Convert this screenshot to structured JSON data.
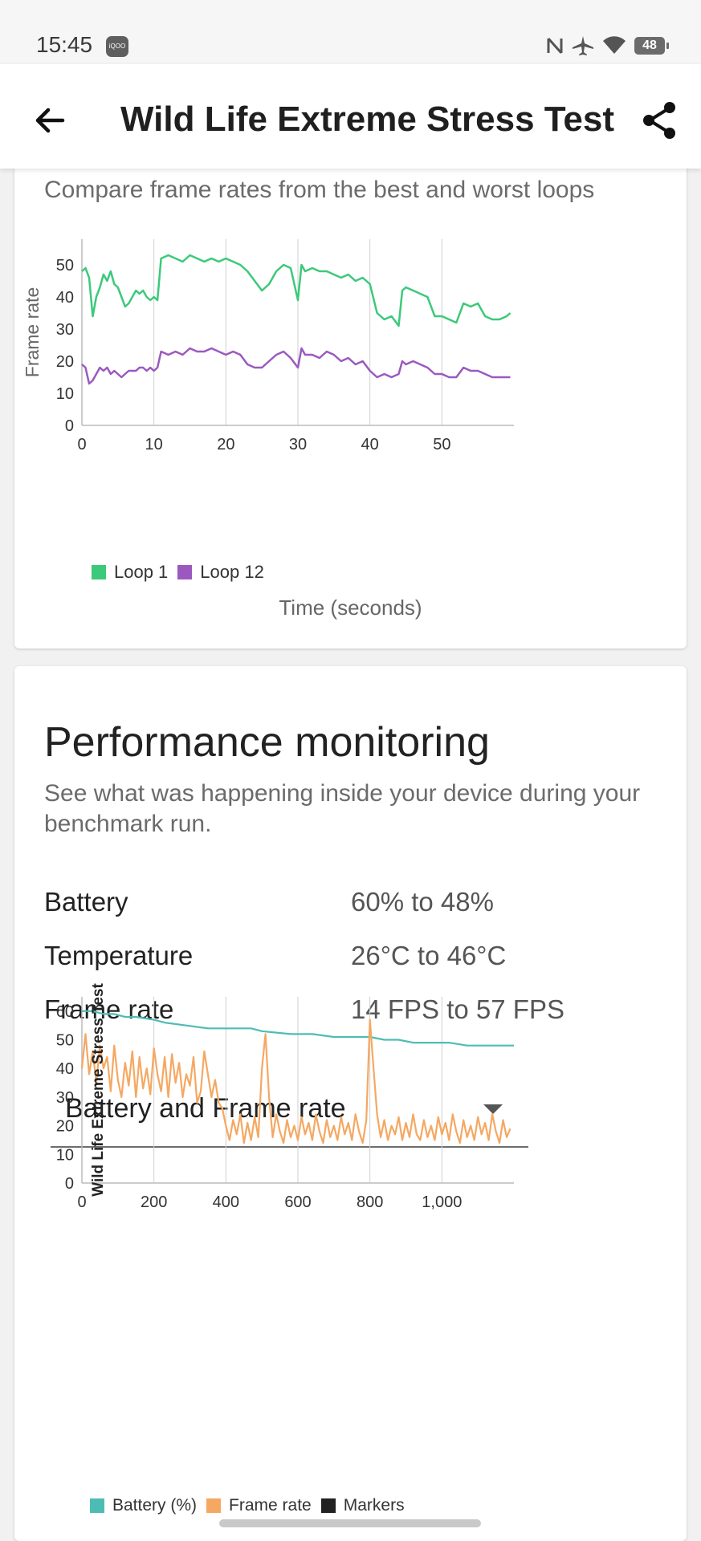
{
  "status_bar": {
    "time": "15:45",
    "app_badge": "iQOO",
    "battery_level": "48",
    "icons": [
      "nfc-icon",
      "airplane-icon",
      "wifi-icon",
      "battery-icon"
    ]
  },
  "app_bar": {
    "title": "Wild Life Extreme Stress Test",
    "back_icon": "arrow-left-icon",
    "share_icon": "share-icon"
  },
  "loops_card": {
    "subtitle": "Compare frame rates from the best and worst loops"
  },
  "performance": {
    "title": "Performance monitoring",
    "description": "See what was happening inside your device during your benchmark run.",
    "stats": [
      {
        "label": "Battery",
        "value": "60% to 48%"
      },
      {
        "label": "Temperature",
        "value": "26°C to 46°C"
      },
      {
        "label": "Frame rate",
        "value": "14 FPS to 57 FPS"
      }
    ],
    "dropdown_selected": "Battery and Frame rate"
  },
  "colors": {
    "loop1": "#3cc97a",
    "loop12": "#9b59c0",
    "battery": "#4dbdb4",
    "frame_rate": "#f5a862",
    "markers": "#222222"
  },
  "chart_data": [
    {
      "type": "line",
      "title": "",
      "xlabel": "Time (seconds)",
      "ylabel": "Frame rate",
      "xlim": [
        0,
        60
      ],
      "ylim": [
        0,
        58
      ],
      "x_ticks": [
        "0",
        "10",
        "20",
        "30",
        "40",
        "50"
      ],
      "y_ticks": [
        "0",
        "10",
        "20",
        "30",
        "40",
        "50"
      ],
      "grid": "vertical",
      "legend_position": "bottom-left",
      "series": [
        {
          "name": "Loop 1",
          "color": "#3cc97a",
          "x": [
            0,
            0.5,
            1,
            1.5,
            2,
            2.5,
            3,
            3.5,
            4,
            4.5,
            5,
            5.5,
            6,
            6.5,
            7,
            7.5,
            8,
            8.5,
            9,
            9.5,
            10,
            10.5,
            11,
            12,
            13,
            14,
            15,
            16,
            17,
            18,
            19,
            20,
            21,
            22,
            23,
            24,
            25,
            26,
            27,
            28,
            29,
            30,
            30.5,
            31,
            32,
            33,
            34,
            35,
            36,
            37,
            38,
            39,
            40,
            41,
            42,
            43,
            44,
            44.5,
            45,
            46,
            47,
            48,
            49,
            50,
            51,
            52,
            53,
            54,
            55,
            56,
            57,
            58,
            59,
            59.5
          ],
          "y": [
            48,
            49,
            46,
            34,
            40,
            43,
            47,
            45,
            48,
            44,
            43,
            40,
            37,
            38,
            40,
            42,
            41,
            42,
            40,
            39,
            40,
            39,
            52,
            53,
            52,
            51,
            53,
            52,
            51,
            52,
            51,
            52,
            51,
            50,
            48,
            45,
            42,
            44,
            48,
            50,
            49,
            39,
            50,
            48,
            49,
            48,
            48,
            47,
            46,
            47,
            45,
            46,
            44,
            35,
            33,
            34,
            31,
            42,
            43,
            42,
            41,
            40,
            34,
            34,
            33,
            32,
            38,
            37,
            38,
            34,
            33,
            33,
            34,
            35
          ]
        },
        {
          "name": "Loop 12",
          "color": "#9b59c0",
          "x": [
            0,
            0.5,
            1,
            1.5,
            2,
            2.5,
            3,
            3.5,
            4,
            4.5,
            5,
            5.5,
            6,
            6.5,
            7,
            7.5,
            8,
            8.5,
            9,
            9.5,
            10,
            10.5,
            11,
            12,
            13,
            14,
            15,
            16,
            17,
            18,
            19,
            20,
            21,
            22,
            23,
            24,
            25,
            26,
            27,
            28,
            29,
            30,
            30.5,
            31,
            32,
            33,
            34,
            35,
            36,
            37,
            38,
            39,
            40,
            41,
            42,
            43,
            44,
            44.5,
            45,
            46,
            47,
            48,
            49,
            50,
            51,
            52,
            53,
            54,
            55,
            56,
            57,
            58,
            59,
            59.5
          ],
          "y": [
            19,
            18,
            13,
            14,
            16,
            18,
            17,
            18,
            16,
            17,
            16,
            15,
            16,
            17,
            17,
            17,
            18,
            18,
            17,
            18,
            17,
            18,
            23,
            22,
            23,
            22,
            24,
            23,
            23,
            24,
            23,
            22,
            23,
            22,
            19,
            18,
            18,
            20,
            22,
            23,
            21,
            18,
            24,
            22,
            22,
            21,
            23,
            22,
            20,
            21,
            19,
            20,
            17,
            15,
            16,
            15,
            16,
            20,
            19,
            20,
            19,
            18,
            16,
            16,
            15,
            15,
            18,
            17,
            17,
            16,
            15,
            15,
            15,
            15
          ]
        }
      ]
    },
    {
      "type": "line",
      "title": "",
      "xlabel": "",
      "ylabel": "Wild Life Extreme Stress Test",
      "xlim": [
        0,
        1200
      ],
      "ylim": [
        0,
        65
      ],
      "x_ticks": [
        "0",
        "200",
        "400",
        "600",
        "800",
        "1,000"
      ],
      "y_ticks": [
        "0",
        "10",
        "20",
        "30",
        "40",
        "50",
        "60"
      ],
      "grid": "vertical",
      "legend_position": "bottom-left",
      "series": [
        {
          "name": "Battery (%)",
          "color": "#4dbdb4",
          "x": [
            0,
            30,
            60,
            90,
            120,
            150,
            200,
            230,
            290,
            350,
            400,
            440,
            470,
            500,
            580,
            640,
            700,
            760,
            800,
            840,
            880,
            920,
            980,
            1020,
            1070,
            1100,
            1120,
            1200
          ],
          "y": [
            60,
            60,
            59,
            59,
            58,
            58,
            57,
            56,
            55,
            54,
            54,
            54,
            54,
            53,
            52,
            52,
            51,
            51,
            51,
            50,
            50,
            49,
            49,
            49,
            48,
            48,
            48,
            48
          ]
        },
        {
          "name": "Frame rate",
          "color": "#f5a862",
          "x": [
            0,
            10,
            20,
            30,
            40,
            50,
            60,
            70,
            80,
            90,
            100,
            110,
            120,
            130,
            140,
            150,
            160,
            170,
            180,
            190,
            200,
            210,
            220,
            230,
            240,
            250,
            260,
            270,
            280,
            290,
            300,
            310,
            320,
            330,
            340,
            350,
            360,
            370,
            380,
            390,
            400,
            410,
            420,
            430,
            440,
            450,
            460,
            470,
            480,
            490,
            500,
            510,
            520,
            530,
            540,
            550,
            560,
            570,
            580,
            590,
            600,
            610,
            620,
            630,
            640,
            650,
            660,
            670,
            680,
            690,
            700,
            710,
            720,
            730,
            740,
            750,
            760,
            770,
            780,
            790,
            800,
            810,
            820,
            830,
            840,
            850,
            860,
            870,
            880,
            890,
            900,
            910,
            920,
            930,
            940,
            950,
            960,
            970,
            980,
            990,
            1000,
            1010,
            1020,
            1030,
            1040,
            1050,
            1060,
            1070,
            1080,
            1090,
            1100,
            1110,
            1120,
            1130,
            1140,
            1150,
            1160,
            1170,
            1180,
            1190
          ],
          "y": [
            40,
            52,
            38,
            46,
            35,
            48,
            40,
            44,
            32,
            48,
            36,
            30,
            42,
            34,
            46,
            30,
            44,
            33,
            40,
            31,
            47,
            38,
            32,
            44,
            30,
            45,
            35,
            42,
            30,
            38,
            34,
            44,
            28,
            32,
            46,
            38,
            30,
            36,
            28,
            26,
            20,
            15,
            22,
            17,
            24,
            14,
            21,
            15,
            23,
            16,
            40,
            52,
            30,
            16,
            24,
            18,
            14,
            22,
            16,
            20,
            15,
            23,
            17,
            21,
            15,
            24,
            18,
            14,
            22,
            16,
            20,
            15,
            23,
            17,
            21,
            15,
            24,
            18,
            14,
            22,
            57,
            40,
            24,
            16,
            22,
            15,
            20,
            17,
            23,
            15,
            21,
            16,
            24,
            17,
            15,
            22,
            16,
            20,
            15,
            23,
            17,
            21,
            15,
            24,
            18,
            14,
            22,
            16,
            20,
            15,
            23,
            17,
            21,
            15,
            24,
            18,
            14,
            22,
            16,
            19
          ]
        },
        {
          "name": "Markers",
          "color": "#222222",
          "x": [],
          "y": []
        }
      ]
    }
  ]
}
